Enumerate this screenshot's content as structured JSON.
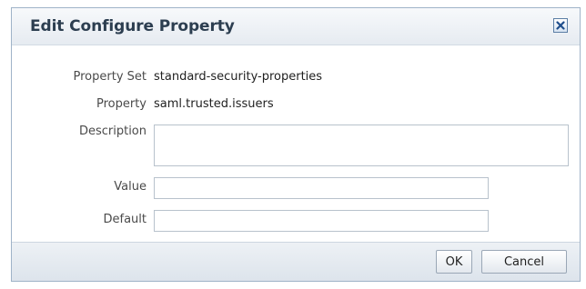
{
  "dialog": {
    "title": "Edit Configure Property",
    "close_icon": "close-icon"
  },
  "form": {
    "property_set": {
      "label": "Property Set",
      "value": "standard-security-properties"
    },
    "property": {
      "label": "Property",
      "value": "saml.trusted.issuers"
    },
    "description": {
      "label": "Description",
      "value": ""
    },
    "value": {
      "label": "Value",
      "value": ""
    },
    "default": {
      "label": "Default",
      "value": ""
    }
  },
  "footer": {
    "ok_label": "OK",
    "cancel_label": "Cancel"
  },
  "colors": {
    "title_text": "#2c3e50",
    "close_icon": "#1f4e8c"
  }
}
